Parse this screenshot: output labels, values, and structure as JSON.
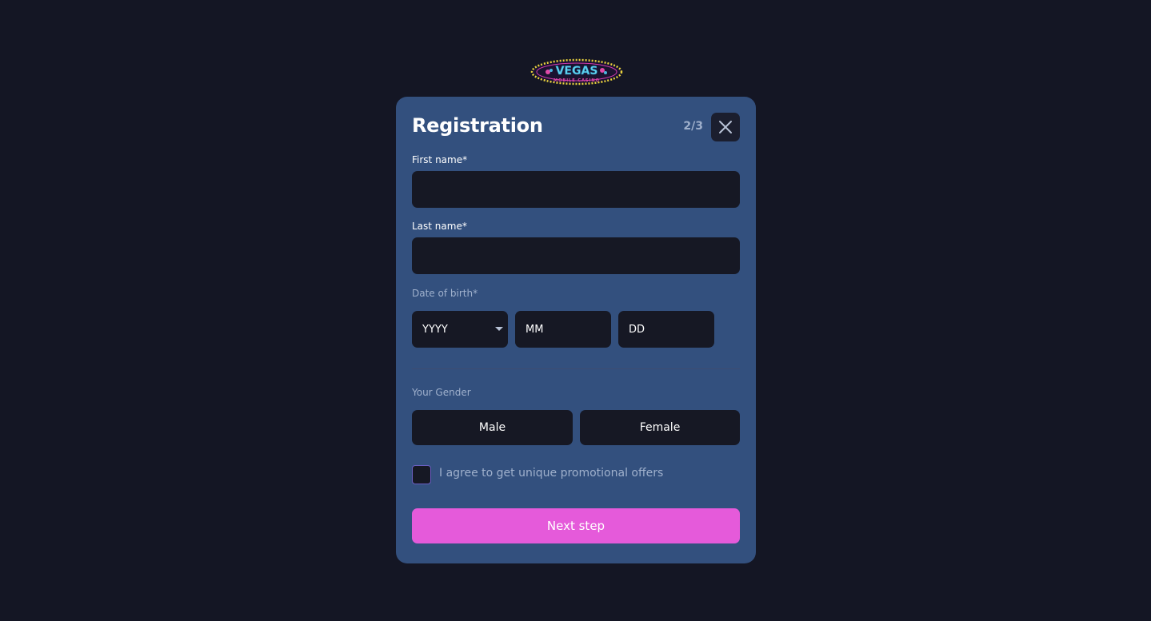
{
  "brand": {
    "logo_text": "VEGAS",
    "logo_subtext": "MOBILE CASINO"
  },
  "modal": {
    "title": "Registration",
    "step": "2/3",
    "close_icon": "close-icon"
  },
  "form": {
    "first_name_label": "First name*",
    "first_name_value": "",
    "last_name_label": "Last name*",
    "last_name_value": "",
    "dob_label": "Date of birth*",
    "dob_year": "YYYY",
    "dob_month": "MM",
    "dob_day": "DD",
    "gender_label": "Your Gender",
    "gender_male": "Male",
    "gender_female": "Female",
    "promo_label": "I agree to get unique promotional offers",
    "next_label": "Next step"
  },
  "colors": {
    "background": "#141624",
    "modal": "#33507e",
    "input": "#161824",
    "accent": "#e55ada"
  }
}
